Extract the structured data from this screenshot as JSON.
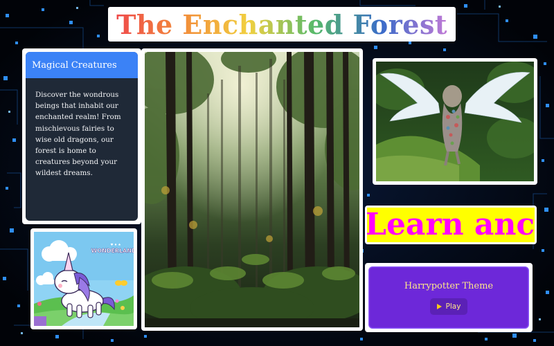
{
  "header": {
    "title": "The Enchanted Forest"
  },
  "creatures_card": {
    "heading": "Magical Creatures",
    "body": "Discover the wondrous beings that inhabit our enchanted realm! From mischievous fairies to wise old dragons, our forest is home to creatures beyond your wildest dreams."
  },
  "unicorn_image": {
    "logo_text": "WONDERLANDS",
    "logo_subtext": "WONDERLANDS"
  },
  "marquee": {
    "text": "Learn ancie"
  },
  "theme_card": {
    "title": "Harrypotter Theme",
    "play_label": "Play",
    "play_icon": "play-triangle-icon"
  },
  "colors": {
    "page_background": "#02050c",
    "card_header": "#3b82f6",
    "card_body": "#1f2937",
    "marquee_background": "#ffff00",
    "marquee_text": "#ff00ff",
    "theme_card": "#6d28d9",
    "theme_text": "#fde68a"
  }
}
